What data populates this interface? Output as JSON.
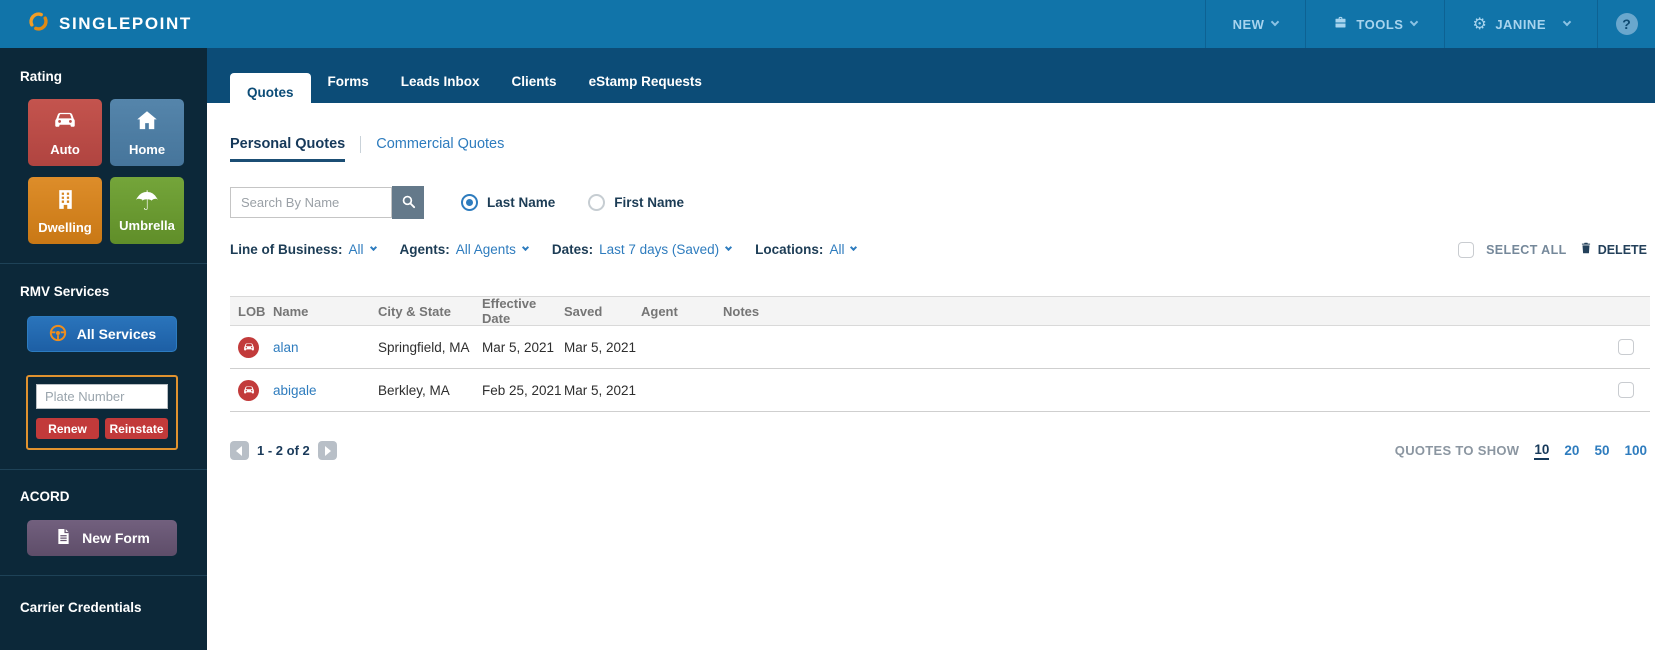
{
  "topbar": {
    "brand": "SINGLEPOINT",
    "new_label": "NEW",
    "tools_label": "TOOLS",
    "user_label": "JANINE",
    "help_label": "?"
  },
  "icons": {
    "gear": "⚙",
    "umbrella": "☂"
  },
  "sidebar": {
    "rating_heading": "Rating",
    "rating_tiles": [
      {
        "label": "Auto",
        "icon": "car-icon",
        "color": "#bd4b47"
      },
      {
        "label": "Home",
        "icon": "home-icon",
        "color": "#4e80a6"
      },
      {
        "label": "Dwelling",
        "icon": "building-icon",
        "color": "#d3821f"
      },
      {
        "label": "Umbrella",
        "icon": "umbrella-icon",
        "color": "#699b2e"
      }
    ],
    "rmv_heading": "RMV Services",
    "all_services_label": "All Services",
    "plate_input_placeholder": "Plate Number",
    "renew_label": "Renew",
    "reinstate_label": "Reinstate",
    "acord_heading": "ACORD",
    "new_form_label": "New Form",
    "carrier_heading": "Carrier Credentials"
  },
  "main": {
    "tabs": [
      {
        "label": "Quotes",
        "active": true
      },
      {
        "label": "Forms",
        "active": false
      },
      {
        "label": "Leads Inbox",
        "active": false
      },
      {
        "label": "Clients",
        "active": false
      },
      {
        "label": "eStamp Requests",
        "active": false
      }
    ],
    "subtabs": {
      "personal_label": "Personal Quotes",
      "commercial_label": "Commercial Quotes",
      "selected": "Personal Quotes"
    },
    "search": {
      "placeholder": "Search By Name",
      "last_name_label": "Last Name",
      "first_name_label": "First Name",
      "selected_radio": "Last Name"
    },
    "filters": [
      {
        "label": "Line of Business:",
        "value": "All"
      },
      {
        "label": "Agents:",
        "value": "All Agents"
      },
      {
        "label": "Dates:",
        "value": "Last 7 days (Saved)"
      },
      {
        "label": "Locations:",
        "value": "All"
      }
    ],
    "bulk_actions": {
      "select_all_label": "SELECT ALL",
      "delete_label": "DELETE"
    },
    "table": {
      "headers": [
        "LOB",
        "Name",
        "City & State",
        "Effective Date",
        "Saved",
        "Agent",
        "Notes"
      ],
      "rows": [
        {
          "lob": "auto",
          "name": "alan",
          "city_state": "Springfield, MA",
          "effective_date": "Mar 5, 2021",
          "saved": "Mar 5, 2021",
          "agent": "",
          "notes": ""
        },
        {
          "lob": "auto",
          "name": "abigale",
          "city_state": "Berkley, MA",
          "effective_date": "Feb 25, 2021",
          "saved": "Mar 5, 2021",
          "agent": "",
          "notes": ""
        }
      ]
    },
    "pagination": {
      "range_label": "1 - 2 of 2"
    },
    "quotes_to_show": {
      "label": "QUOTES TO SHOW",
      "options": [
        "10",
        "20",
        "50",
        "100"
      ],
      "selected": "10"
    }
  },
  "colors": {
    "topbar_blue": "#1174a9",
    "tabstrip_blue": "#0c4c77",
    "sidebar_navy": "#0c2839",
    "link_blue": "#2e7cbe",
    "auto_red": "#bd4b47",
    "home_blue": "#4e80a6",
    "dwelling_orange": "#d3821f",
    "umbrella_green": "#699b2e",
    "danger_red": "#c23a3a",
    "rmv_border_orange": "#e0922f",
    "acord_purple": "#6a5875",
    "brand_orange": "#f09d26",
    "lob_badge_red": "#c23b3b",
    "dark_text": "#1c3c55"
  }
}
